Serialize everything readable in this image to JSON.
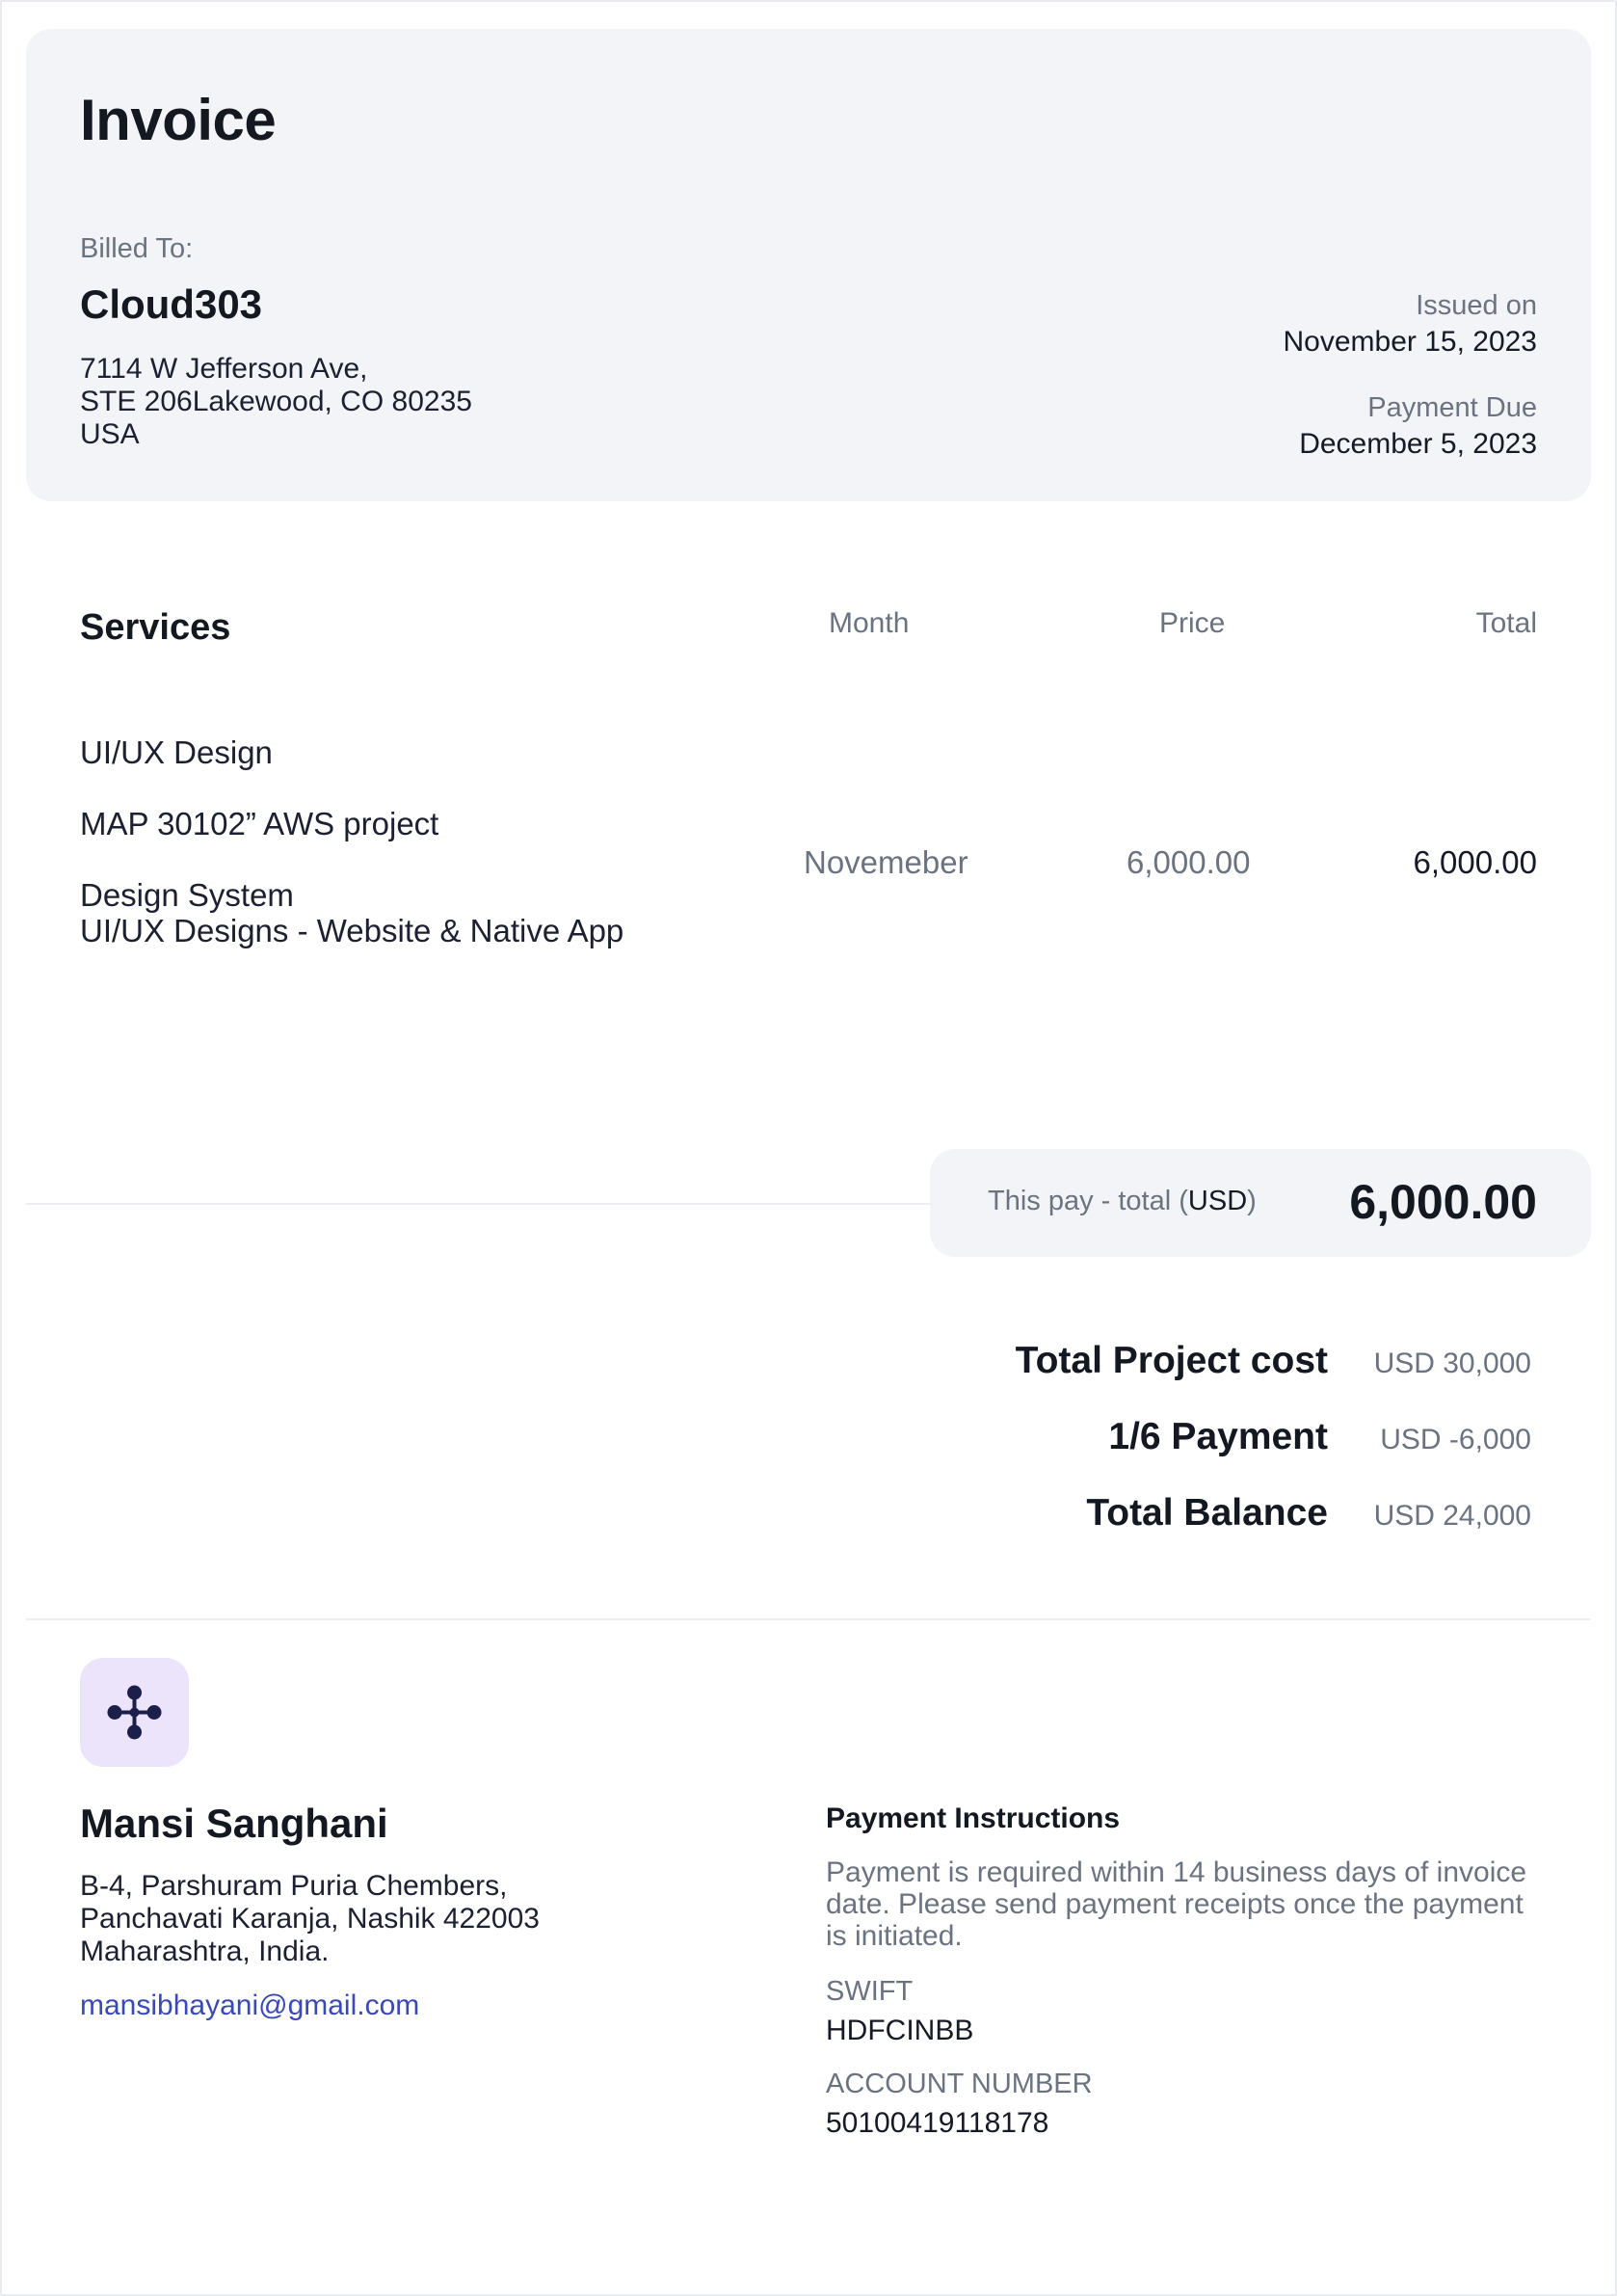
{
  "invoice": {
    "title": "Invoice",
    "billed_to_label": "Billed To:",
    "client_name": "Cloud303",
    "client_address": [
      "7114 W Jefferson Ave,",
      "STE 206Lakewood, CO 80235",
      "USA"
    ],
    "issued_label": "Issued on",
    "issued_date": "November 15, 2023",
    "due_label": "Payment Due",
    "due_date": "December 5, 2023"
  },
  "services": {
    "title": "Services",
    "col_month": "Month",
    "col_price": "Price",
    "col_total": "Total",
    "items": [
      "UI/UX Design",
      "MAP 30102” AWS project",
      "Design System",
      "UI/UX Designs - Website & Native App"
    ],
    "month": "Novemeber",
    "price": "6,000.00",
    "total": "6,000.00"
  },
  "payment_total": {
    "label": "This pay - total",
    "currency": "USD",
    "amount": "6,000.00"
  },
  "summary": [
    {
      "label": "Total Project cost",
      "value": "USD 30,000"
    },
    {
      "label": "1/6 Payment",
      "value": "USD -6,000"
    },
    {
      "label": "Total Balance",
      "value": "USD 24,000"
    }
  ],
  "sender": {
    "logo_icon": "four-dot-network-icon",
    "name": "Mansi Sanghani",
    "address": [
      "B-4, Parshuram Puria Chembers,",
      "Panchavati Karanja, Nashik 422003",
      "Maharashtra, India."
    ],
    "email": "mansibhayani@gmail.com"
  },
  "payment_instructions": {
    "title": "Payment Instructions",
    "text": "Payment is required within 14 business days of invoice date. Please send payment receipts once the payment is initiated.",
    "swift_label": "SWIFT",
    "swift": "HDFCINBB",
    "account_label": "ACCOUNT NUMBER",
    "account": "50100419118178"
  },
  "colors": {
    "card_bg": "#f3f4f7",
    "logo_bg": "#ebe4fb",
    "logo_fg": "#1c1f4a",
    "link": "#3949b5",
    "muted": "#6b7380"
  }
}
